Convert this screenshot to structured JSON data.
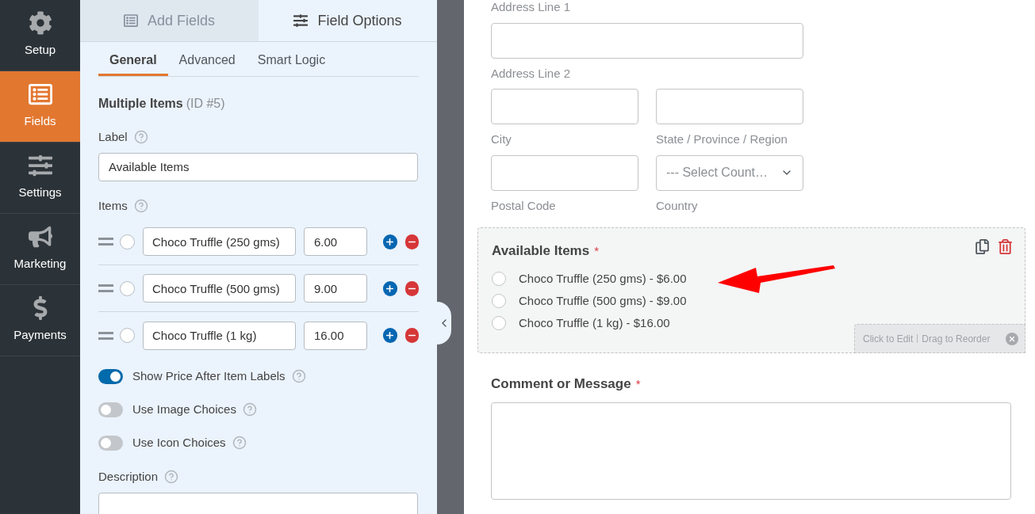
{
  "sidebar": {
    "items": [
      {
        "label": "Setup",
        "selected": false
      },
      {
        "label": "Fields",
        "selected": true
      },
      {
        "label": "Settings",
        "selected": false
      },
      {
        "label": "Marketing",
        "selected": false
      },
      {
        "label": "Payments",
        "selected": false
      }
    ]
  },
  "panel_tabs": [
    {
      "label": "Add Fields",
      "selected": false
    },
    {
      "label": "Field Options",
      "selected": true
    }
  ],
  "sub_tabs": [
    {
      "label": "General",
      "selected": true
    },
    {
      "label": "Advanced",
      "selected": false
    },
    {
      "label": "Smart Logic",
      "selected": false
    }
  ],
  "field_title": {
    "name": "Multiple Items",
    "id_text": "(ID #5)"
  },
  "label_field": {
    "label": "Label",
    "value": "Available Items"
  },
  "items": {
    "label": "Items",
    "rows": [
      {
        "name": "Choco Truffle (250 gms)",
        "price": "6.00",
        "selected": false
      },
      {
        "name": "Choco Truffle (500 gms)",
        "price": "9.00",
        "selected": false
      },
      {
        "name": "Choco Truffle (1 kg)",
        "price": "16.00",
        "selected": false
      }
    ]
  },
  "toggles": [
    {
      "label": "Show Price After Item Labels",
      "on": true
    },
    {
      "label": "Use Image Choices",
      "on": false
    },
    {
      "label": "Use Icon Choices",
      "on": false
    }
  ],
  "description": {
    "label": "Description"
  },
  "form": {
    "address": {
      "line1_label": "Address Line 1",
      "line2_label": "Address Line 2",
      "city_label": "City",
      "state_label": "State / Province / Region",
      "postal_label": "Postal Code",
      "country_label": "Country",
      "country_placeholder": "--- Select Count…"
    },
    "available_items": {
      "label": "Available Items",
      "options": [
        {
          "label": "Choco Truffle (250 gms) - $6.00",
          "selected": false
        },
        {
          "label": "Choco Truffle (500 gms) - $9.00",
          "selected": false
        },
        {
          "label": "Choco Truffle (1 kg) - $16.00",
          "selected": false
        }
      ],
      "hint_edit": "Click to Edit",
      "hint_reorder": "Drag to Reorder",
      "required_mark": "*"
    },
    "comment": {
      "label": "Comment or Message",
      "required_mark": "*"
    }
  }
}
